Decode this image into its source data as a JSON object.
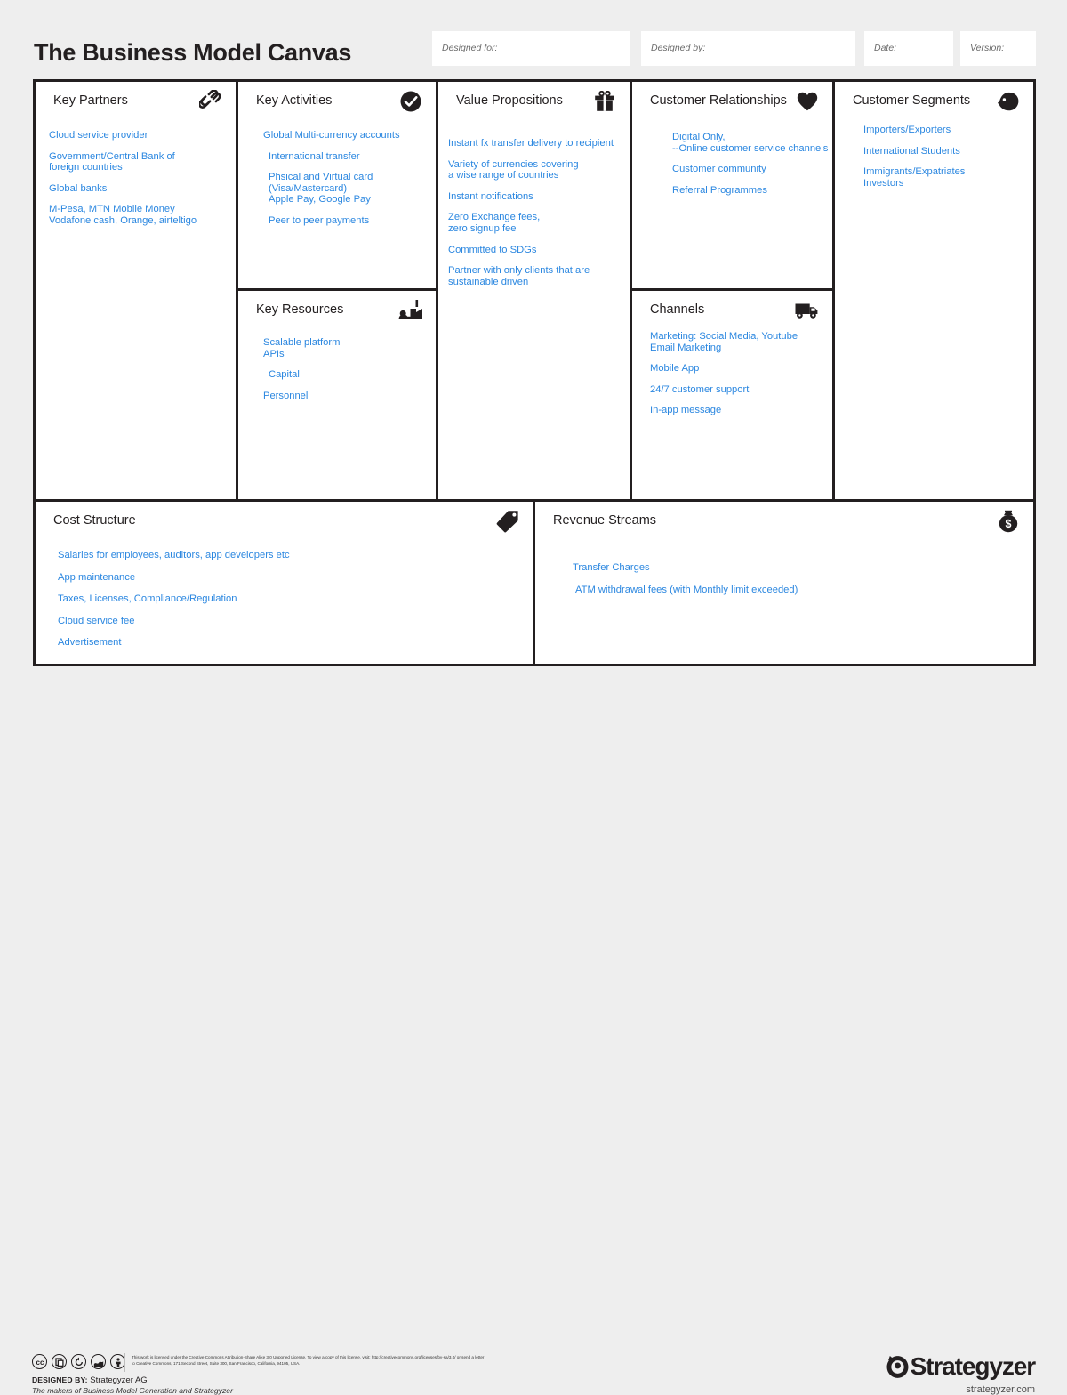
{
  "header": {
    "title": "The Business Model Canvas",
    "meta_fields": [
      {
        "name": "designed-for",
        "label": "Designed for:",
        "value": ""
      },
      {
        "name": "designed-by",
        "label": "Designed by:",
        "value": ""
      },
      {
        "name": "date",
        "label": "Date:",
        "value": ""
      },
      {
        "name": "version",
        "label": "Version:",
        "value": ""
      }
    ]
  },
  "colors": {
    "note_blue": "#2b87e0",
    "ink": "#231f20",
    "page_background": "#eeeeee",
    "cell_background": "#ffffff"
  },
  "blocks": {
    "key_partners": {
      "title": "Key Partners",
      "icon": "link-chain-icon",
      "notes": [
        "Cloud service provider",
        "Government/Central Bank of\nforeign countries",
        "Global banks",
        "M-Pesa, MTN Mobile Money\nVodafone cash, Orange, airteltigo"
      ]
    },
    "key_activities": {
      "title": "Key Activities",
      "icon": "check-circle-icon",
      "notes": [
        "Global Multi-currency accounts",
        "International transfer",
        "Phsical and Virtual card\n(Visa/Mastercard)\nApple Pay, Google Pay",
        "Peer to peer payments"
      ]
    },
    "key_resources": {
      "title": "Key Resources",
      "icon": "factory-worker-icon",
      "notes": [
        "Scalable platform\nAPIs",
        "Capital",
        "Personnel"
      ]
    },
    "value_propositions": {
      "title": "Value Propositions",
      "icon": "gift-icon",
      "notes": [
        "Instant fx transfer delivery to recipient",
        "Variety of currencies covering\na wise range of countries",
        "Instant notifications",
        "Zero Exchange fees,\nzero signup fee",
        "Committed to SDGs",
        "Partner with only clients that are\nsustainable driven"
      ]
    },
    "customer_relationships": {
      "title": "Customer Relationships",
      "icon": "heart-icon",
      "notes": [
        "Digital Only,\n--Online customer service channels",
        "Customer community",
        "Referral Programmes"
      ]
    },
    "channels": {
      "title": "Channels",
      "icon": "delivery-truck-icon",
      "notes": [
        "Marketing: Social Media, Youtube\nEmail Marketing",
        "Mobile App",
        "24/7 customer support",
        "In-app message"
      ]
    },
    "customer_segments": {
      "title": "Customer Segments",
      "icon": "head-profile-icon",
      "notes": [
        "Importers/Exporters",
        "International Students",
        "Immigrants/Expatriates\nInvestors"
      ]
    },
    "cost_structure": {
      "title": "Cost Structure",
      "icon": "price-tag-icon",
      "notes": [
        "Salaries for employees, auditors, app developers etc",
        "App maintenance",
        "Taxes, Licenses, Compliance/Regulation",
        "Cloud service fee",
        "Advertisement"
      ]
    },
    "revenue_streams": {
      "title": "Revenue Streams",
      "icon": "money-bag-icon",
      "notes": [
        "Transfer Charges",
        "ATM withdrawal fees (with Monthly limit exceeded)"
      ]
    }
  },
  "footer": {
    "license_text": "This work is licensed under the Creative Commons Attribution-Share Alike 3.0 Unported License. To view a copy of this license, visit: http://creativecommons.org/licenses/by-sa/3.0/ or send a letter to Creative Commons, 171 Second Street, Suite 300, San Francisco, California, 94105, USA.",
    "designed_by_label": "DESIGNED BY:",
    "designed_by_value": "Strategyzer AG",
    "makers_line": "The makers of Business Model Generation and Strategyzer",
    "brand_name": "Strategyzer",
    "brand_url": "strategyzer.com",
    "cc_icons": [
      "cc-icon",
      "cc-copy-icon",
      "cc-share-alike-icon",
      "cc-remix-icon",
      "cc-by-person-icon"
    ]
  }
}
